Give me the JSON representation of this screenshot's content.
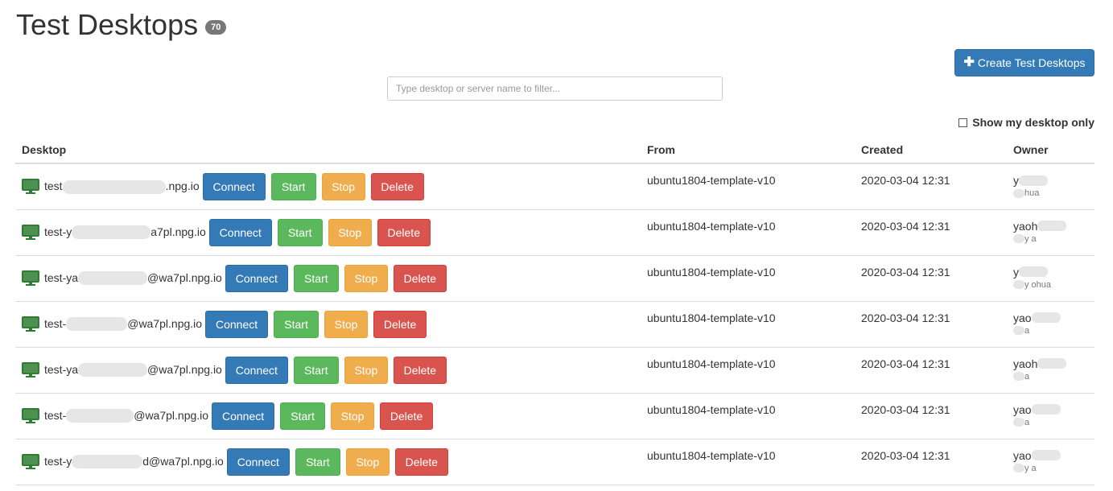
{
  "page": {
    "title": "Test Desktops",
    "count": "70",
    "create_label": "Create Test Desktops",
    "filter_placeholder": "Type desktop or server name to filter...",
    "show_mine_label": "Show my desktop only"
  },
  "colors": {
    "primary": "#337ab7",
    "success": "#5cb85c",
    "warning": "#f0ad4e",
    "danger": "#d9534f",
    "icon": "#2e7d32"
  },
  "icons": {
    "desktop": "monitor-icon",
    "create": "plus-icon"
  },
  "table": {
    "headers": {
      "desktop": "Desktop",
      "from": "From",
      "created": "Created",
      "owner": "Owner"
    },
    "actions": {
      "connect": "Connect",
      "start": "Start",
      "stop": "Stop",
      "delete": "Delete"
    },
    "rows": [
      {
        "name_prefix": "test",
        "name_suffix": ".npg.io",
        "from": "ubuntu1804-template-v10",
        "created": "2020-03-04 12:31",
        "owner": "y",
        "owner_sub": "hua"
      },
      {
        "name_prefix": "test-y",
        "name_suffix": "a7pl.npg.io",
        "from": "ubuntu1804-template-v10",
        "created": "2020-03-04 12:31",
        "owner": "yaoh",
        "owner_sub": "y a"
      },
      {
        "name_prefix": "test-ya",
        "name_suffix": "@wa7pl.npg.io",
        "from": "ubuntu1804-template-v10",
        "created": "2020-03-04 12:31",
        "owner": "y",
        "owner_sub": "y ohua"
      },
      {
        "name_prefix": "test-",
        "name_suffix": "@wa7pl.npg.io",
        "from": "ubuntu1804-template-v10",
        "created": "2020-03-04 12:31",
        "owner": "yao",
        "owner_sub": "a"
      },
      {
        "name_prefix": "test-ya",
        "name_suffix": "@wa7pl.npg.io",
        "from": "ubuntu1804-template-v10",
        "created": "2020-03-04 12:31",
        "owner": "yaoh",
        "owner_sub": "a"
      },
      {
        "name_prefix": "test-",
        "name_suffix": "@wa7pl.npg.io",
        "from": "ubuntu1804-template-v10",
        "created": "2020-03-04 12:31",
        "owner": "yao",
        "owner_sub": "a"
      },
      {
        "name_prefix": "test-y",
        "name_suffix": "d@wa7pl.npg.io",
        "from": "ubuntu1804-template-v10",
        "created": "2020-03-04 12:31",
        "owner": "yao",
        "owner_sub": "y a"
      }
    ]
  }
}
